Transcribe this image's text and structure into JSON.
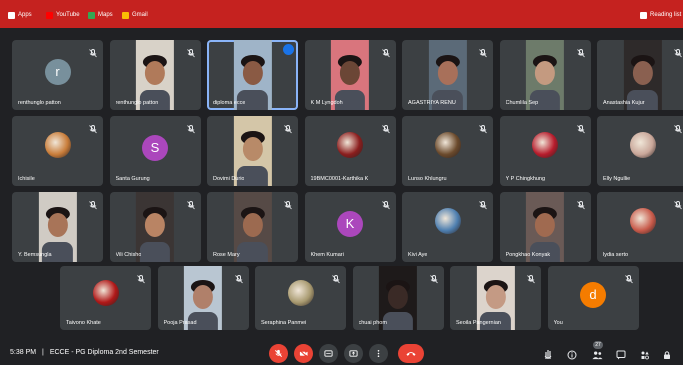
{
  "bookmarks": [
    {
      "label": "Apps",
      "icon": "apps-grid-icon"
    },
    {
      "label": "YouTube",
      "icon": "youtube-icon"
    },
    {
      "label": "Maps",
      "icon": "maps-icon"
    },
    {
      "label": "Gmail",
      "icon": "gmail-icon"
    }
  ],
  "reading_list": "Reading list",
  "tiles": [
    {
      "name": "renthunglo patton",
      "kind": "avatar",
      "initial": "r",
      "color": "#78909c"
    },
    {
      "name": "renthunglo patton",
      "kind": "video",
      "bg": "#d8d2c8",
      "skin": "#b07a5a"
    },
    {
      "name": "diploma ecce",
      "kind": "video",
      "bg": "#9fb4c8",
      "skin": "#8a5a44",
      "selected": true
    },
    {
      "name": "K M Lyngdoh",
      "kind": "video",
      "bg": "#d9757d",
      "skin": "#6b4636"
    },
    {
      "name": "AGASTRIYA RENU",
      "kind": "video",
      "bg": "#5b6a78",
      "skin": "#a8705a"
    },
    {
      "name": "Chumlila Sep",
      "kind": "video",
      "bg": "#6d7b6a",
      "skin": "#c49a80"
    },
    {
      "name": "Anastashia Kujur",
      "kind": "video",
      "bg": "#2e2a2a",
      "skin": "#8a6050"
    },
    {
      "name": "Ichisile",
      "kind": "photo",
      "color": "#c97d3a"
    },
    {
      "name": "Santa Gurung",
      "kind": "avatar",
      "initial": "S",
      "color": "#ab47bc"
    },
    {
      "name": "Dovimi Durio",
      "kind": "video",
      "bg": "#d4c6a8",
      "skin": "#b88a68"
    },
    {
      "name": "19BMC0001-Karthika K",
      "kind": "photo",
      "color": "#8b1e1e"
    },
    {
      "name": "Lunso Khlungru",
      "kind": "photo",
      "color": "#6b4a2c"
    },
    {
      "name": "Y P Chingkhung",
      "kind": "photo",
      "color": "#b71c2c"
    },
    {
      "name": "Elly Ngullie",
      "kind": "photo",
      "color": "#c9a79a"
    },
    {
      "name": "Y. Bemsungla",
      "kind": "video",
      "bg": "#d0cbc4",
      "skin": "#a87458"
    },
    {
      "name": "Vili Chisho",
      "kind": "video",
      "bg": "#3b3534",
      "skin": "#b98464"
    },
    {
      "name": "Rose Mary",
      "kind": "video",
      "bg": "#564a46",
      "skin": "#9c6a50"
    },
    {
      "name": "Khem Kumari",
      "kind": "avatar",
      "initial": "K",
      "color": "#ab47bc"
    },
    {
      "name": "Kivi Aye",
      "kind": "photo",
      "color": "#4e7fb0"
    },
    {
      "name": "Pongkhao Konyak",
      "kind": "video",
      "bg": "#6a5a56",
      "skin": "#a06a50"
    },
    {
      "name": "lydia serto",
      "kind": "photo",
      "color": "#c85a4a"
    },
    {
      "name": "Taivono Khate",
      "kind": "photo",
      "color": "#b01818"
    },
    {
      "name": "Pooja Prasad",
      "kind": "video",
      "bg": "#b9c6d2",
      "skin": "#b0806a"
    },
    {
      "name": "Seraphina Panmei",
      "kind": "photo",
      "color": "#a89a70"
    },
    {
      "name": "chuai phom",
      "kind": "video",
      "bg": "#1e1a1a",
      "skin": "#3a2a26"
    },
    {
      "name": "Seoila Pangernian",
      "kind": "video",
      "bg": "#dcd4cc",
      "skin": "#c49a84"
    },
    {
      "name": "You",
      "kind": "avatar",
      "initial": "d",
      "color": "#f57c00"
    }
  ],
  "meeting": {
    "time": "5:38 PM",
    "separator": "|",
    "title": "ECCE - PG Diploma 2nd Semester",
    "participant_count": "27"
  },
  "controls": [
    {
      "name": "mic-off-button",
      "icon": "mic-off-icon",
      "style": "red"
    },
    {
      "name": "camera-off-button",
      "icon": "camera-off-icon",
      "style": "red"
    },
    {
      "name": "captions-button",
      "icon": "captions-icon",
      "style": "grey"
    },
    {
      "name": "present-button",
      "icon": "present-screen-icon",
      "style": "grey"
    },
    {
      "name": "more-options-button",
      "icon": "more-vert-icon",
      "style": "grey"
    },
    {
      "name": "leave-call-button",
      "icon": "end-call-icon",
      "style": "end"
    }
  ],
  "right_controls": [
    {
      "name": "hand-raise-button",
      "icon": "raise-hand-icon"
    },
    {
      "name": "info-button",
      "icon": "info-icon"
    },
    {
      "name": "people-button",
      "icon": "people-icon"
    },
    {
      "name": "chat-button",
      "icon": "chat-icon"
    },
    {
      "name": "activities-button",
      "icon": "activities-icon"
    },
    {
      "name": "host-controls-button",
      "icon": "lock-icon"
    }
  ]
}
